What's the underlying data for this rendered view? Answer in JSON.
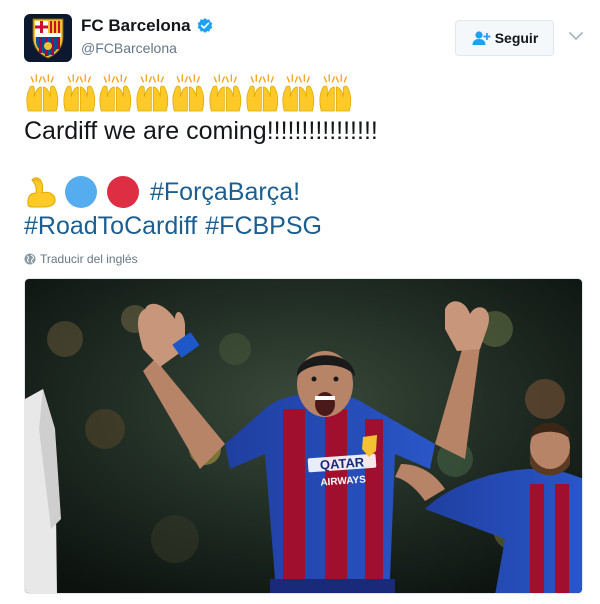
{
  "account": {
    "name": "FC Barcelona",
    "handle": "@FCBarcelona",
    "avatar_icon": "fc-barcelona-crest-icon",
    "verified_icon": "verified-badge-icon"
  },
  "follow_button": {
    "label": "Seguir",
    "icon": "add-user-icon"
  },
  "menu_icon": "chevron-down-icon",
  "tweet": {
    "clap_emoji_count": 9,
    "line1": "Cardiff we are coming!!!!!!!!!!!!!!!!",
    "emoji_row": [
      "flexed-biceps-icon",
      "blue-circle-icon",
      "red-circle-icon"
    ],
    "hashtags_row1": [
      "#ForçaBarça!"
    ],
    "hashtags_row2": [
      "#RoadToCardiff",
      "#FCBPSG"
    ]
  },
  "translate": {
    "label": "Traducir del inglés",
    "icon": "globe-icon"
  },
  "photo": {
    "description_icon": "celebrating-player-photo",
    "shirt_sponsor": "QATAR",
    "shirt_sponsor_sub": "AIRWAYS"
  },
  "colors": {
    "hashtag": "#1b5f92",
    "muted": "#657786",
    "verified": "#1da1f2",
    "blue_circle": "#55acee",
    "red_circle": "#dd2e44"
  }
}
